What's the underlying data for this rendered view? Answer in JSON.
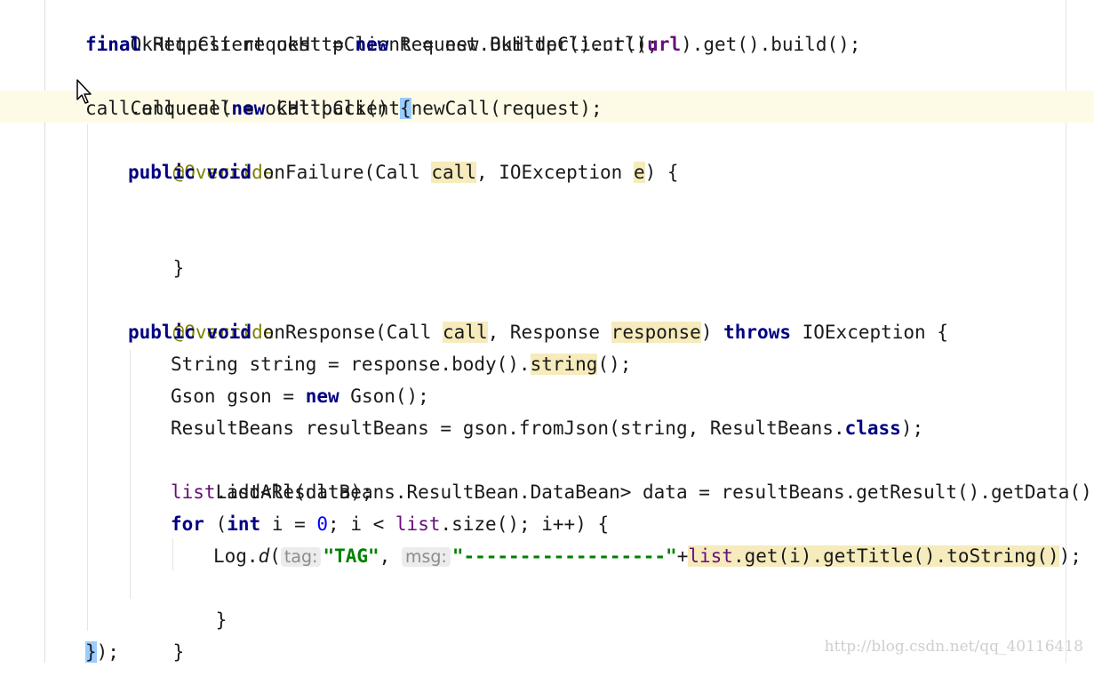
{
  "editor": {
    "code": {
      "okhttpclient_decl": "OkHttpClient okHttpClient = new OkHttpClient();",
      "request_decl_1": "final",
      "request_decl_2": " Request request = ",
      "request_decl_3": "new",
      "request_decl_4": " Request.Builder().url(",
      "request_decl_url": "url",
      "request_decl_5": ").get().build();",
      "call_decl": "Call call = okHttpClient.newCall(request);",
      "enqueue_1": "call.enqueue(",
      "enqueue_new": "new",
      "enqueue_2": " Callback() ",
      "open_brace": "{",
      "override": "@Override",
      "public_void": "public void",
      "on_failure": " onFailure(Call ",
      "call_param": "call",
      "ioexception_param": ", IOException ",
      "e_param": "e",
      "on_failure_end": ") {",
      "close_brace": "}",
      "on_response": " onResponse(Call ",
      "response_type": ", Response ",
      "response_param": "response",
      "paren_close": ") ",
      "throws": "throws",
      "ioexception_open": " IOException {",
      "string_decl_1": "String string = response.body().",
      "string_call": "string",
      "string_decl_2": "();",
      "gson_decl_1": "Gson gson = ",
      "gson_new": "new",
      "gson_decl_2": " Gson();",
      "resultbeans_decl_1": "ResultBeans resultBeans = gson.fromJson(string, ResultBeans.",
      "class_kw": "class",
      "resultbeans_decl_2": ");",
      "list_decl": "List<ResultBeans.ResultBean.DataBean> data = resultBeans.getResult().getData();",
      "list_field": "list",
      "addall": ".addAll(data);",
      "for_kw": "for",
      "for_1": " (",
      "int_kw": "int",
      "for_2": " i = ",
      "zero": "0",
      "for_3": "; i < ",
      "for_4": ".size(); i++) {",
      "log_1": "Log.",
      "log_d": "d",
      "log_paren": "(",
      "hint_tag": "tag:",
      "tag_str": "\"TAG\"",
      "comma": ", ",
      "hint_msg": "msg:",
      "msg_str": "\"------------------\"",
      "plus": "+",
      "get_title": ".get(i).getTitle().toString()",
      "log_end": ");",
      "final_brace_end": ");"
    },
    "watermark": "http://blog.csdn.net/qq_40116418"
  }
}
